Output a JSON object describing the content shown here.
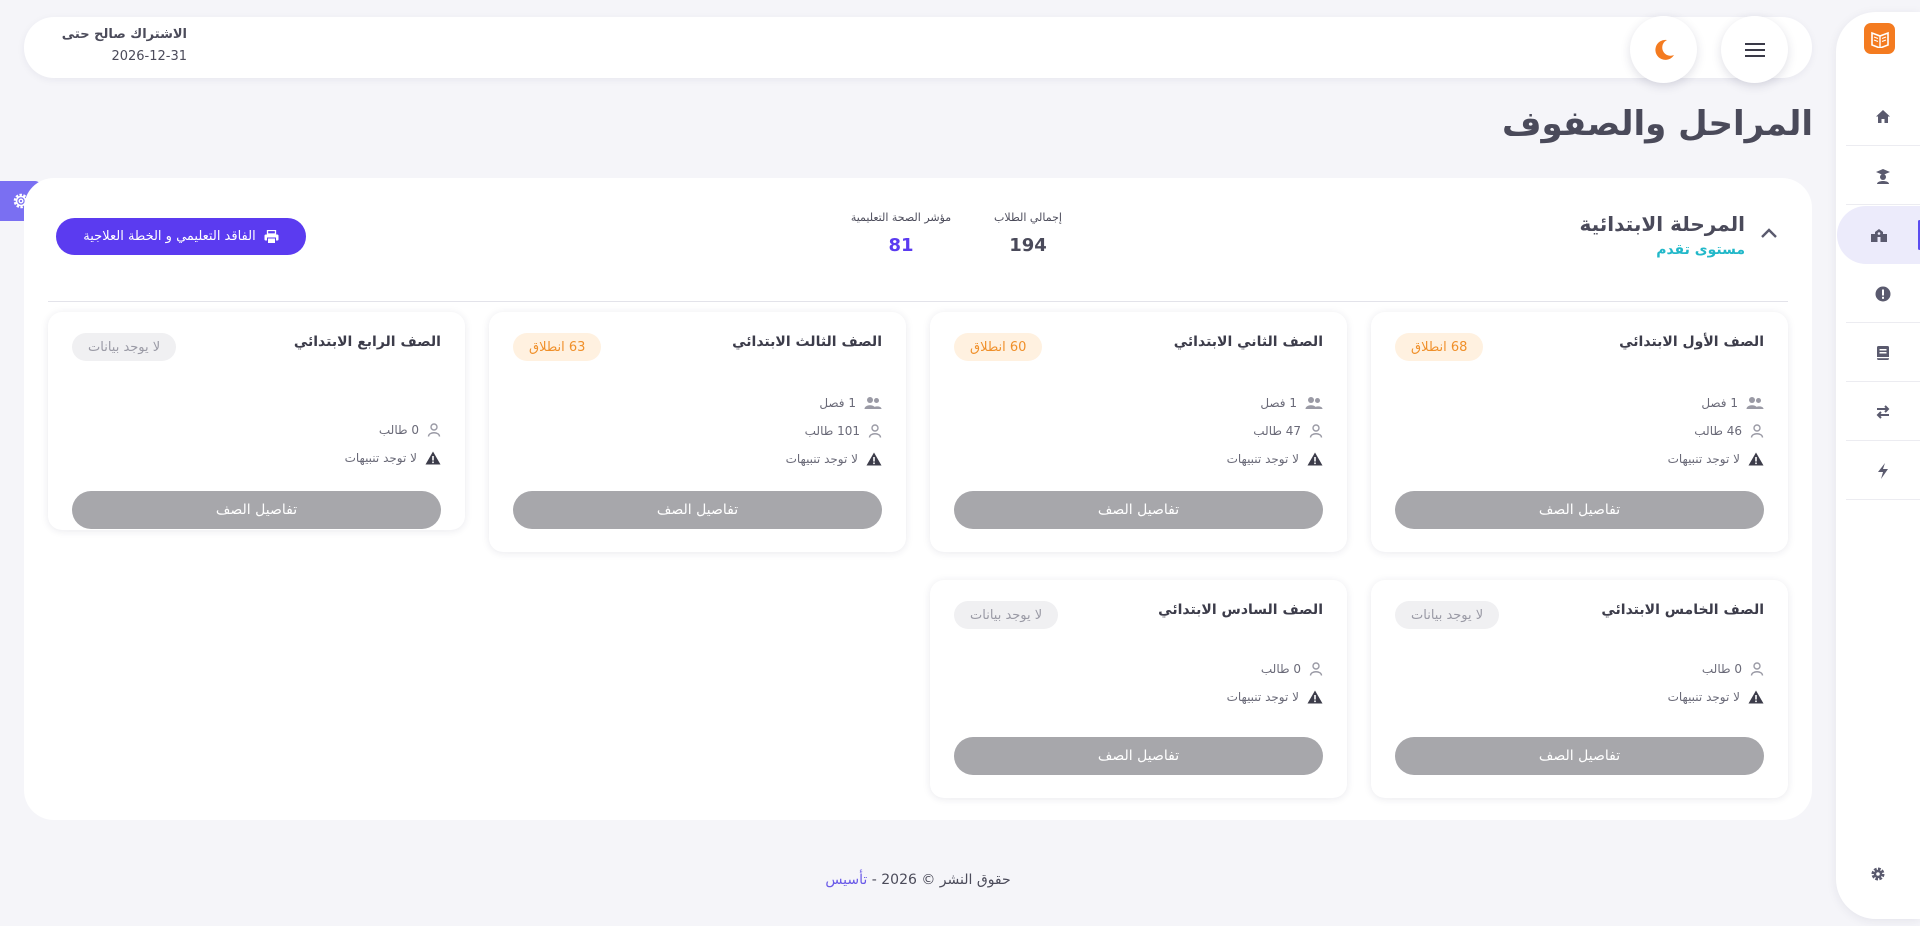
{
  "header": {
    "subscription_label": "الاشتراك صالح حتى",
    "subscription_date": "2026-12-31",
    "menu_icon": "hamburger-menu-icon",
    "theme_icon": "moon-icon"
  },
  "page": {
    "title": "المراحل والصفوف"
  },
  "sidebar": {
    "logo_icon": "book-logo-icon",
    "items": [
      {
        "icon": "home-icon",
        "active": false
      },
      {
        "icon": "graduate-icon",
        "active": false
      },
      {
        "icon": "school-icon",
        "active": true
      },
      {
        "icon": "alert-circle-icon",
        "active": false
      },
      {
        "icon": "book-icon",
        "active": false
      },
      {
        "icon": "transfer-icon",
        "active": false
      },
      {
        "icon": "bolt-icon",
        "active": false
      },
      {
        "icon": "settings-icon",
        "active": false
      }
    ]
  },
  "stage": {
    "title": "المرحلة الابتدائية",
    "level": "مستوى تقدم",
    "stats": [
      {
        "label": "إجمالي الطلاب",
        "value": "194"
      },
      {
        "label": "مؤشر الصحة التعليمية",
        "value": "81"
      }
    ],
    "print_label": "الفاقد التعليمي و الخطة العلاجية"
  },
  "grades": [
    {
      "name": "الصف الأول الابتدائي",
      "badge": "68 انطلاق",
      "classes": "1 فصل",
      "students": "46 طالب",
      "alerts": "لا توجد تنبيهات",
      "button": "تفاصيل الصف"
    },
    {
      "name": "الصف الثاني الابتدائي",
      "badge": "60 انطلاق",
      "classes": "1 فصل",
      "students": "47 طالب",
      "alerts": "لا توجد تنبيهات",
      "button": "تفاصيل الصف"
    },
    {
      "name": "الصف الثالث الابتدائي",
      "badge": "63 انطلاق",
      "classes": "1 فصل",
      "students": "101 طالب",
      "alerts": "لا توجد تنبيهات",
      "button": "تفاصيل الصف"
    },
    {
      "name": "الصف الرابع الابتدائي",
      "badge": "لا يوجد بيانات",
      "students": "0 طالب",
      "alerts": "لا توجد تنبيهات",
      "button": "تفاصيل الصف"
    },
    {
      "name": "الصف الخامس الابتدائي",
      "badge": "لا يوجد بيانات",
      "students": "0 طالب",
      "alerts": "لا توجد تنبيهات",
      "button": "تفاصيل الصف"
    },
    {
      "name": "الصف السادس الابتدائي",
      "badge": "لا يوجد بيانات",
      "students": "0 طالب",
      "alerts": "لا توجد تنبيهات",
      "button": "تفاصيل الصف"
    }
  ],
  "footer": {
    "text": "حقوق النشر © 2026 -",
    "brand": "تأسيس"
  },
  "colors": {
    "accent": "#5b3bf0",
    "teal": "#22b8c9",
    "orange": "#f47b20",
    "stat_students": "#4a4a5a",
    "stat_health": "#5b3bf0"
  }
}
